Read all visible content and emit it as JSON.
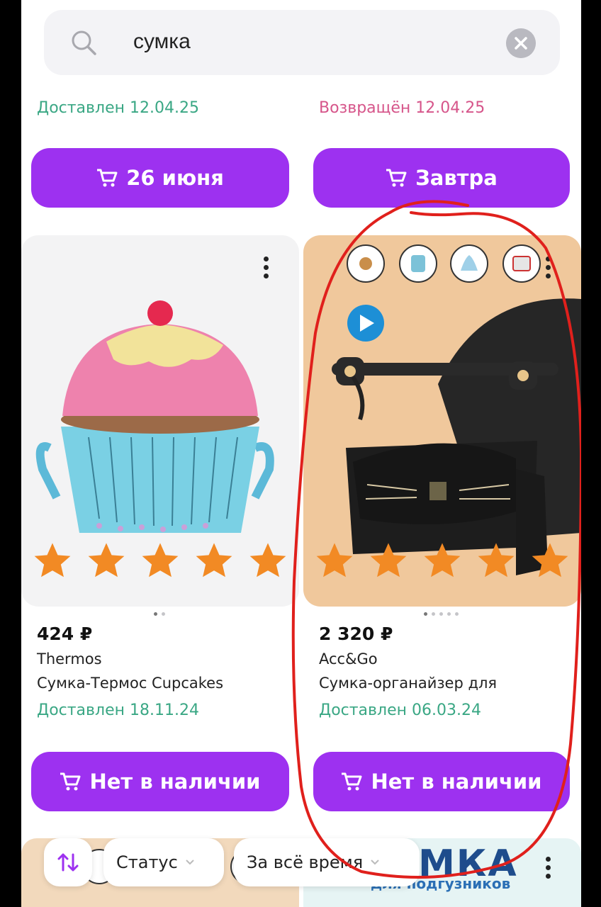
{
  "search": {
    "query": "сумка"
  },
  "previous_row": {
    "left": {
      "status": "Доставлен 12.04.25",
      "button": "26 июня"
    },
    "right": {
      "status": "Возвращён 12.04.25",
      "button": "Завтра"
    }
  },
  "products": [
    {
      "price": "424 ₽",
      "brand": "Thermos",
      "title": "Сумка-Термос Cupcakes",
      "status": "Доставлен 18.11.24",
      "button": "Нет в наличии",
      "rating": 5
    },
    {
      "price": "2 320 ₽",
      "brand": "Acc&Go",
      "title": "Сумка-органайзер для",
      "status": "Доставлен 06.03.24",
      "button": "Нет в наличии",
      "rating": 5
    }
  ],
  "next_row": {
    "right_banner": "УМКА",
    "right_sub": "для подгузников"
  },
  "filters": {
    "status_label": "Статус",
    "period_label": "За всё время"
  },
  "colors": {
    "accent": "#9d31f0",
    "status_green": "#3aa784",
    "status_pink": "#d6558a",
    "star": "#f28a24",
    "annotation": "#e0201c"
  }
}
